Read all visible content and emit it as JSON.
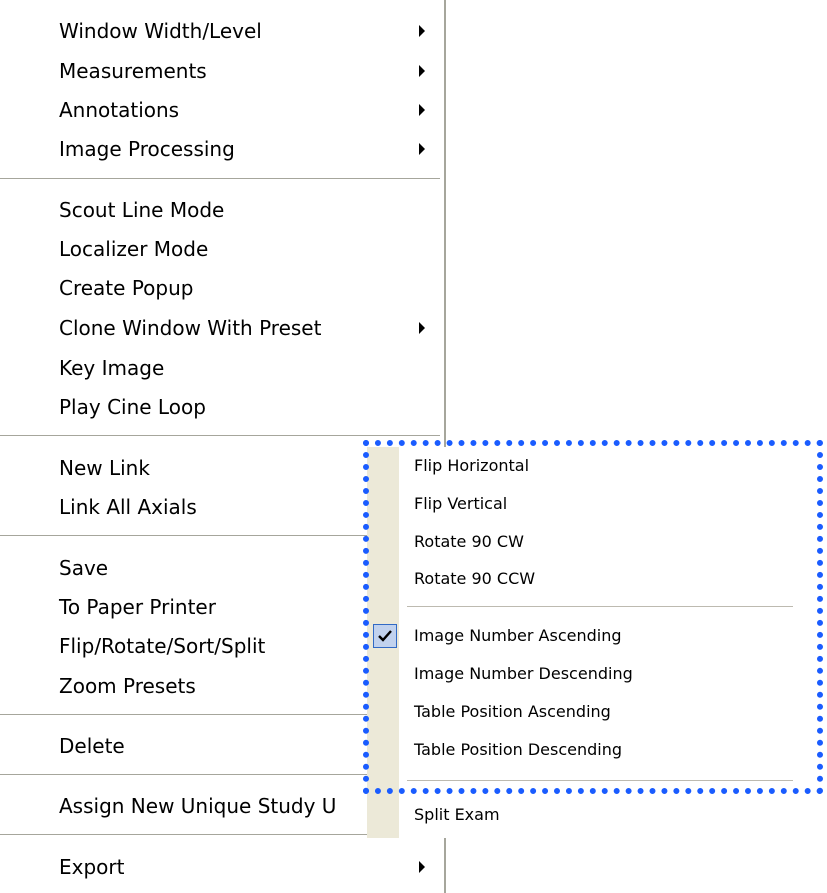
{
  "main_menu": {
    "items": [
      {
        "label": "Window Width/Level",
        "submenu": true
      },
      {
        "label": "Measurements",
        "submenu": true
      },
      {
        "label": "Annotations",
        "submenu": true
      },
      {
        "label": "Image Processing",
        "submenu": true
      },
      {
        "label": "Scout Line Mode",
        "submenu": false
      },
      {
        "label": "Localizer Mode",
        "submenu": false
      },
      {
        "label": "Create Popup",
        "submenu": false
      },
      {
        "label": "Clone Window With Preset",
        "submenu": true
      },
      {
        "label": "Key Image",
        "submenu": false
      },
      {
        "label": "Play Cine Loop",
        "submenu": false
      },
      {
        "label": "New Link",
        "submenu": false
      },
      {
        "label": "Link All Axials",
        "submenu": false
      },
      {
        "label": "Save",
        "submenu": false
      },
      {
        "label": "To Paper Printer",
        "submenu": false
      },
      {
        "label": "Flip/Rotate/Sort/Split",
        "submenu": false
      },
      {
        "label": "Zoom Presets",
        "submenu": false
      },
      {
        "label": "Delete",
        "submenu": false
      },
      {
        "label": "Assign New Unique Study U",
        "submenu": false
      },
      {
        "label": "Export",
        "submenu": true
      }
    ]
  },
  "sub_menu": {
    "items": [
      {
        "label": "Flip Horizontal"
      },
      {
        "label": "Flip Vertical"
      },
      {
        "label": "Rotate 90 CW"
      },
      {
        "label": "Rotate 90 CCW"
      },
      {
        "label": "Image Number Ascending",
        "checked": true
      },
      {
        "label": "Image Number Descending"
      },
      {
        "label": "Table Position Ascending"
      },
      {
        "label": "Table Position Descending"
      },
      {
        "label": "Split Exam"
      }
    ]
  },
  "colors": {
    "highlight_frame": "#1a5cff",
    "gutter": "#ece9d8",
    "separator": "#a6a69c"
  }
}
